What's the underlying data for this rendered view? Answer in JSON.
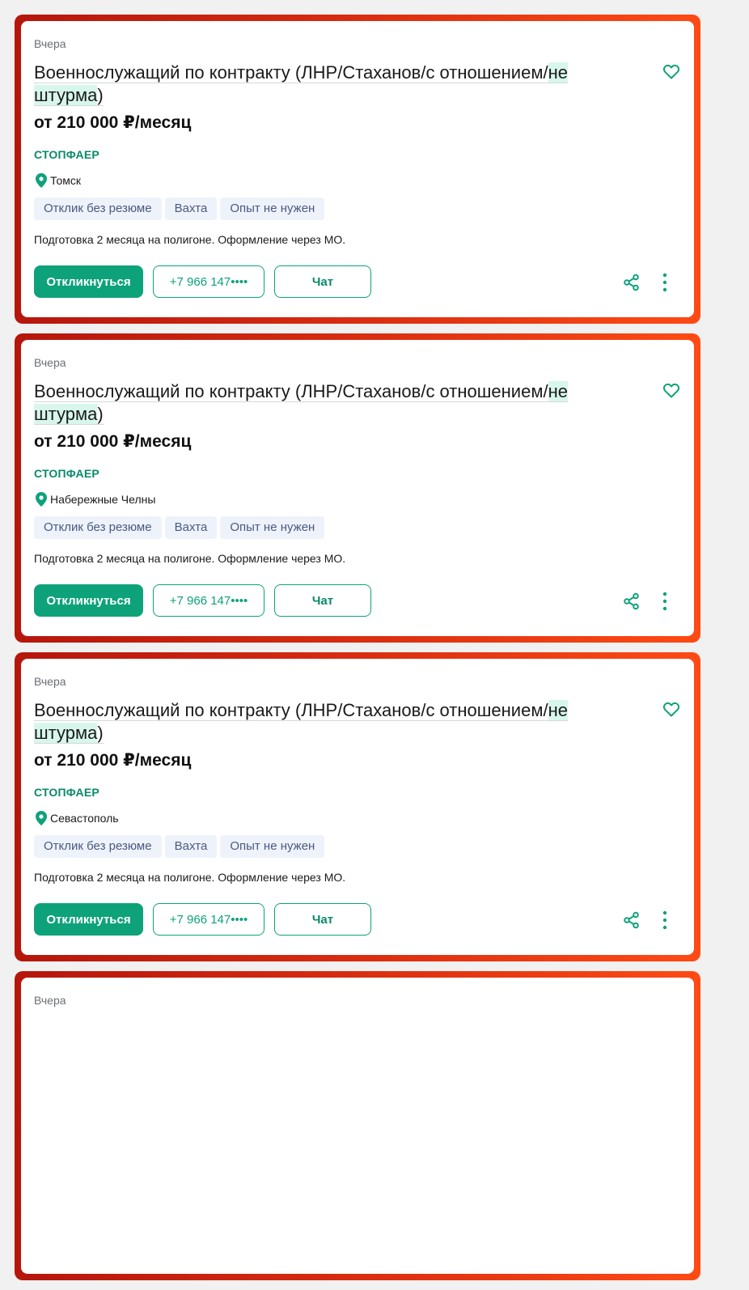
{
  "colors": {
    "accent": "#0ea27a",
    "frame_start": "#b5160c",
    "frame_end": "#ff4a14",
    "tag_bg": "#eef2fa",
    "tag_text": "#4a5a80",
    "highlight": "#d8f7ec"
  },
  "vacancies": [
    {
      "date": "Вчера",
      "title_before": "Военнослужащий по контракту (ЛНР/Стаханов/с отношением/",
      "title_highlight_1": "не",
      "title_highlight_2": "штурма",
      "title_after": ")",
      "salary": "от 210 000 ₽/месяц",
      "company": "СТОПФАЕР",
      "location": "Томск",
      "tags": [
        "Отклик без резюме",
        "Вахта",
        "Опыт не нужен"
      ],
      "description": "Подготовка 2 месяца на полигоне. Оформление через МО.",
      "apply_label": "Откликнуться",
      "phone_label": "+7 966 147••••",
      "chat_label": "Чат",
      "icons": [
        "heart-icon",
        "location-pin-icon",
        "share-icon",
        "more-vertical-icon"
      ]
    },
    {
      "date": "Вчера",
      "title_before": "Военнослужащий по контракту (ЛНР/Стаханов/с отношением/",
      "title_highlight_1": "не",
      "title_highlight_2": "штурма",
      "title_after": ")",
      "salary": "от 210 000 ₽/месяц",
      "company": "СТОПФАЕР",
      "location": "Набережные Челны",
      "tags": [
        "Отклик без резюме",
        "Вахта",
        "Опыт не нужен"
      ],
      "description": "Подготовка 2 месяца на полигоне. Оформление через МО.",
      "apply_label": "Откликнуться",
      "phone_label": "+7 966 147••••",
      "chat_label": "Чат",
      "icons": [
        "heart-icon",
        "location-pin-icon",
        "share-icon",
        "more-vertical-icon"
      ]
    },
    {
      "date": "Вчера",
      "title_before": "Военнослужащий по контракту (ЛНР/Стаханов/с отношением/",
      "title_highlight_1": "не",
      "title_highlight_2": "штурма",
      "title_after": ")",
      "salary": "от 210 000 ₽/месяц",
      "company": "СТОПФАЕР",
      "location": "Севастополь",
      "tags": [
        "Отклик без резюме",
        "Вахта",
        "Опыт не нужен"
      ],
      "description": "Подготовка 2 месяца на полигоне. Оформление через МО.",
      "apply_label": "Откликнуться",
      "phone_label": "+7 966 147••••",
      "chat_label": "Чат",
      "icons": [
        "heart-icon",
        "location-pin-icon",
        "share-icon",
        "more-vertical-icon"
      ]
    },
    {
      "date": "Вчера"
    }
  ]
}
